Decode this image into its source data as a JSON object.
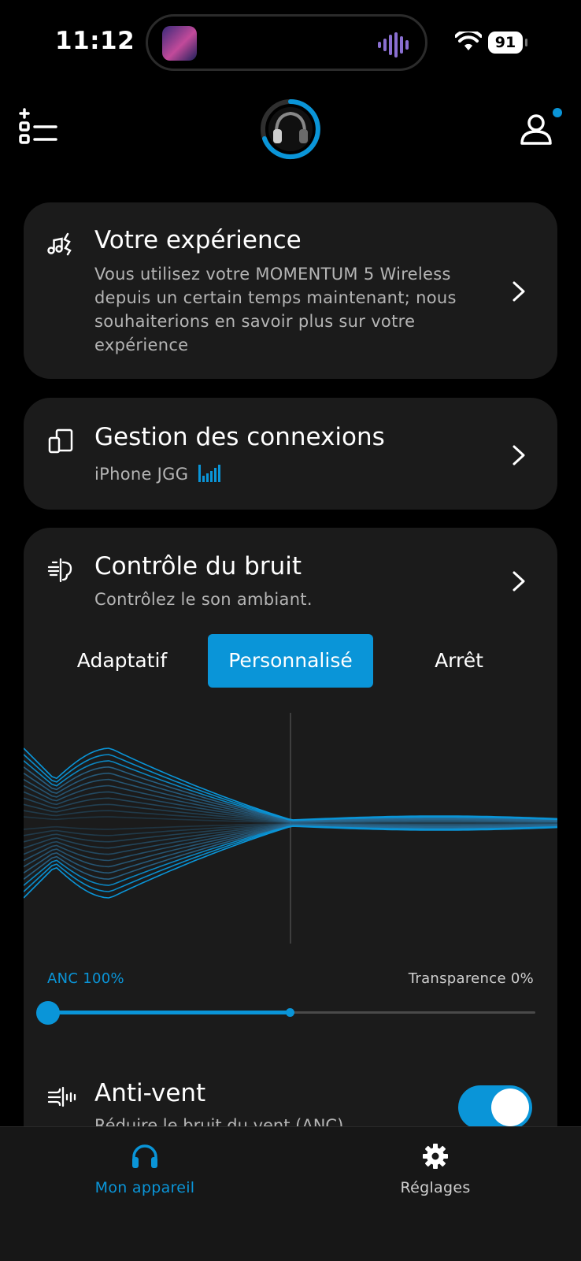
{
  "status_bar": {
    "time": "11:12",
    "battery": "91"
  },
  "experience": {
    "title": "Votre expérience",
    "desc_lines": [
      "Vous utilisez votre MOMENTUM 5 Wireless",
      "depuis un certain temps maintenant; nous",
      "souhaiterions en savoir plus sur votre",
      "expérience"
    ]
  },
  "connections": {
    "title": "Gestion des connexions",
    "device": "iPhone JGG"
  },
  "noise": {
    "title": "Contrôle du bruit",
    "subtitle": "Contrôlez le son ambiant.",
    "modes": [
      "Adaptatif",
      "Personnalisé",
      "Arrêt"
    ],
    "selected_mode": "Personnalisé",
    "anc_label": "ANC 100%",
    "transparency_label": "Transparence 0%",
    "slider_value": 0
  },
  "anti_wind": {
    "title": "Anti-vent",
    "subtitle": "Réduire le bruit du vent (ANC)",
    "enabled": true
  },
  "tabs": {
    "device": "Mon appareil",
    "settings": "Réglages"
  },
  "colors": {
    "accent": "#0a95d8",
    "card": "#1b1b1b",
    "background": "#000000"
  }
}
